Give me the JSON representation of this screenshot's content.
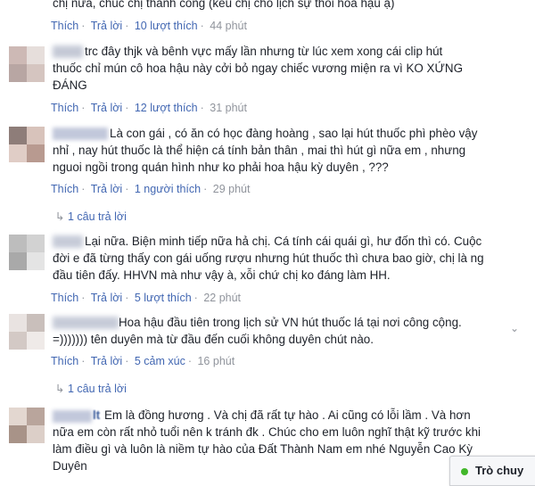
{
  "top_comment": {
    "text_tail": "chị nữa, chúc chị thành công (kêu chị cho lịch sự thôi hoa hậu ạ)",
    "like": "Thích",
    "reply": "Trả lời",
    "likes": "10 lượt thích",
    "time": "44 phút"
  },
  "comments": [
    {
      "line1": "trc đây thjk và bênh vực mấy lần nhưng từ lúc xem xong cái clip hút",
      "line2": "thuốc chỉ mún cô hoa hậu này cởi bỏ ngay chiếc vương miện ra vì KO XỨNG",
      "line3": "ĐÁNG",
      "like": "Thích",
      "reply": "Trả lời",
      "likes": "12 lượt thích",
      "time": "31 phút"
    },
    {
      "author": "Thuy Nga",
      "line1": "Là con gái , có ăn có học đàng hoàng , sao lại hút thuốc phì phèo vậy",
      "line2": "nhỉ , nay hút thuốc là thể hiện cá tính bản thân , mai thì hút gì nữa em , nhưng",
      "line3": "nguoi ngồi trong quán hình như ko phải hoa hậu kỳ duyên , ???",
      "like": "Thích",
      "reply": "Trả lời",
      "likes": "1 người thích",
      "time": "29 phút",
      "replies": "1 câu trả lời"
    },
    {
      "line1": "Lại nữa. Biện minh tiếp nữa hả chị. Cá tính cái quái gì, hư đốn thì có. Cuộc",
      "line2": "đời e đã từng thấy con gái uống rượu nhưng hút thuốc thì chưa bao giờ, chị là ng",
      "line3": "đầu tiên đấy. HHVN mà như vậy à, xỗi chứ chị ko đáng làm HH.",
      "like": "Thích",
      "reply": "Trả lời",
      "likes": "5 lượt thích",
      "time": "22 phút"
    },
    {
      "line1": "Hoa hậu đầu tiên trong lịch sử VN hút thuốc lá tại nơi công cộng.",
      "line2": "=))))))) tên duyên mà từ đầu đến cuối không duyên chút nào.",
      "like": "Thích",
      "reply": "Trả lời",
      "likes": "5 cảm xúc",
      "time": "16 phút",
      "replies": "1 câu trả lời"
    },
    {
      "author_suffix": "lt",
      "line1": "Em là đồng hương . Và chị đã rất tự hào . Ai cũng có lỗi lầm . Và hơn",
      "line2": "nữa em còn rất nhỏ tuổi nên k tránh đk . Chúc cho em luôn nghĩ thật kỹ trước khi",
      "line3": "làm điều gì và luôn là niềm tự hào của Đất Thành Nam em nhé Nguyễn Cao Kỳ",
      "line4": "Duyên"
    }
  ],
  "chat": {
    "label": "Trò chuy"
  },
  "colors": {
    "link": "#4267b2",
    "meta": "#90949c",
    "text": "#1d2129",
    "online": "#42b72a"
  }
}
